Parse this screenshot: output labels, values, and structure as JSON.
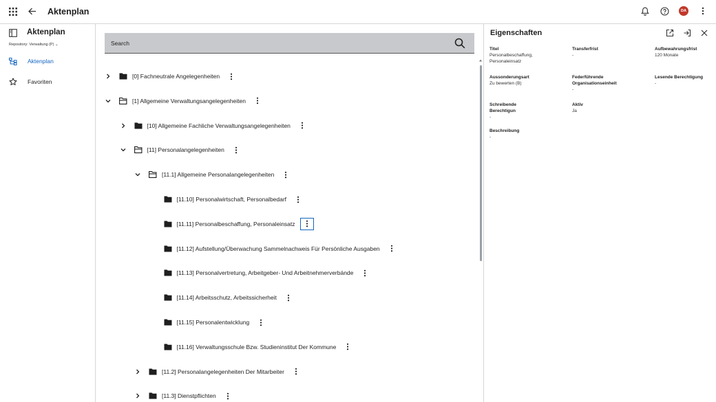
{
  "topbar": {
    "title": "Aktenplan",
    "avatar_initials": "DA",
    "avatar_color": "#c0392b"
  },
  "sidebar": {
    "app_name": "Aktenplan",
    "repository": "Repository: Verwaltung (P) ⌄",
    "items": [
      {
        "label": "Aktenplan",
        "icon": "hierarchy-icon",
        "active": true
      },
      {
        "label": "Favoriten",
        "icon": "star-icon",
        "active": false
      }
    ]
  },
  "search": {
    "placeholder": "Search"
  },
  "tree": [
    {
      "label": "[0] Fachneutrale Angelegenheiten",
      "level": 0,
      "expanded": false,
      "has_children": true
    },
    {
      "label": "[1] Allgemeine Verwaltungsangelegenheiten",
      "level": 0,
      "expanded": true,
      "has_children": true
    },
    {
      "label": "[10] Allgemeine Fachliche Verwaltungsangelegenheiten",
      "level": 1,
      "expanded": false,
      "has_children": true
    },
    {
      "label": "[11] Personalangelegenheiten",
      "level": 1,
      "expanded": true,
      "has_children": true
    },
    {
      "label": "[11.1] Allgemeine Personalangelegenheiten",
      "level": 2,
      "expanded": true,
      "has_children": true
    },
    {
      "label": "[11.10] Personalwirtschaft, Personalbedarf",
      "level": 3,
      "expanded": false,
      "has_children": false
    },
    {
      "label": "[11.11] Personalbeschaffung, Personaleinsatz",
      "level": 3,
      "expanded": false,
      "has_children": false,
      "focused": true
    },
    {
      "label": "[11.12] Aufstellung/Überwachung Sammelnachweis Für Persönliche Ausgaben",
      "level": 3,
      "expanded": false,
      "has_children": false
    },
    {
      "label": "[11.13] Personalvertretung, Arbeitgeber- Und Arbeitnehmerverbände",
      "level": 3,
      "expanded": false,
      "has_children": false
    },
    {
      "label": "[11.14] Arbeitsschutz, Arbeitssicherheit",
      "level": 3,
      "expanded": false,
      "has_children": false
    },
    {
      "label": "[11.15] Personalentwicklung",
      "level": 3,
      "expanded": false,
      "has_children": false
    },
    {
      "label": "[11.16] Verwaltungsschule Bzw. Studieninstitut Der Kommune",
      "level": 3,
      "expanded": false,
      "has_children": false
    },
    {
      "label": "[11.2] Personalangelegenheiten Der Mitarbeiter",
      "level": 2,
      "expanded": false,
      "has_children": true
    },
    {
      "label": "[11.3] Dienstpflichten",
      "level": 2,
      "expanded": false,
      "has_children": true
    }
  ],
  "properties": {
    "title": "Eigenschaften",
    "fields": [
      {
        "label": "Titel",
        "value": "Personalbeschaffung, Personaleinsatz"
      },
      {
        "label": "Transferfrist",
        "value": "-"
      },
      {
        "label": "Aufbewahrungsfrist",
        "value": "120 Monate"
      },
      {
        "label": "Aussonderungsart",
        "value": "Zu bewerten (B)"
      },
      {
        "label": "Federführende Organisationseinheit",
        "value": "-"
      },
      {
        "label": "Lesende Berechtigung",
        "value": "-"
      },
      {
        "label": "Schreibende Berechtigun",
        "value": "-"
      },
      {
        "label": "Aktiv",
        "value": "Ja"
      },
      {
        "label": "Beschreibung",
        "value": "-"
      }
    ]
  },
  "colors": {
    "accent": "#1565c0",
    "search_bg": "#c7c9cc",
    "divider": "#d6d6d6"
  }
}
